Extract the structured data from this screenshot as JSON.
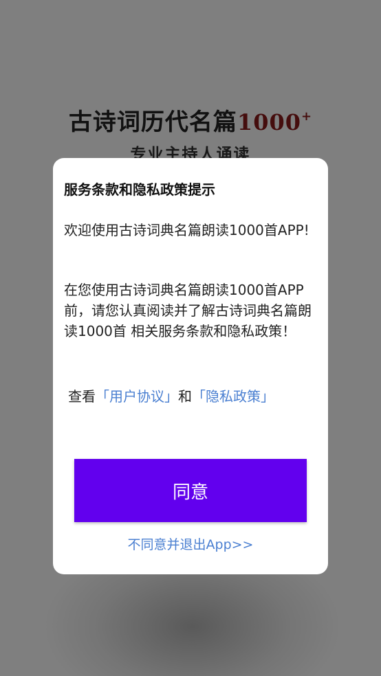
{
  "splash": {
    "title_main": "古诗词历代名篇",
    "title_count": "1000",
    "title_plus": "+",
    "subtitle": "专业主持人诵读"
  },
  "dialog": {
    "title": "服务条款和隐私政策提示",
    "para1": "欢迎使用古诗词典名篇朗读1000首APP!",
    "para2": "在您使用古诗词典名篇朗读1000首APP前，请您认真阅读并了解古诗词典名篇朗读1000首 相关服务条款和隐私政策！",
    "links_prefix": "查看",
    "user_agreement": "「用户协议」",
    "links_and": "和",
    "privacy_policy": "「隐私政策」",
    "agree_label": "同意",
    "exit_label": "不同意并退出App>>"
  },
  "colors": {
    "primary_button": "#6200ee",
    "link": "#4a7fd1",
    "title_accent": "#8b1a1a"
  }
}
